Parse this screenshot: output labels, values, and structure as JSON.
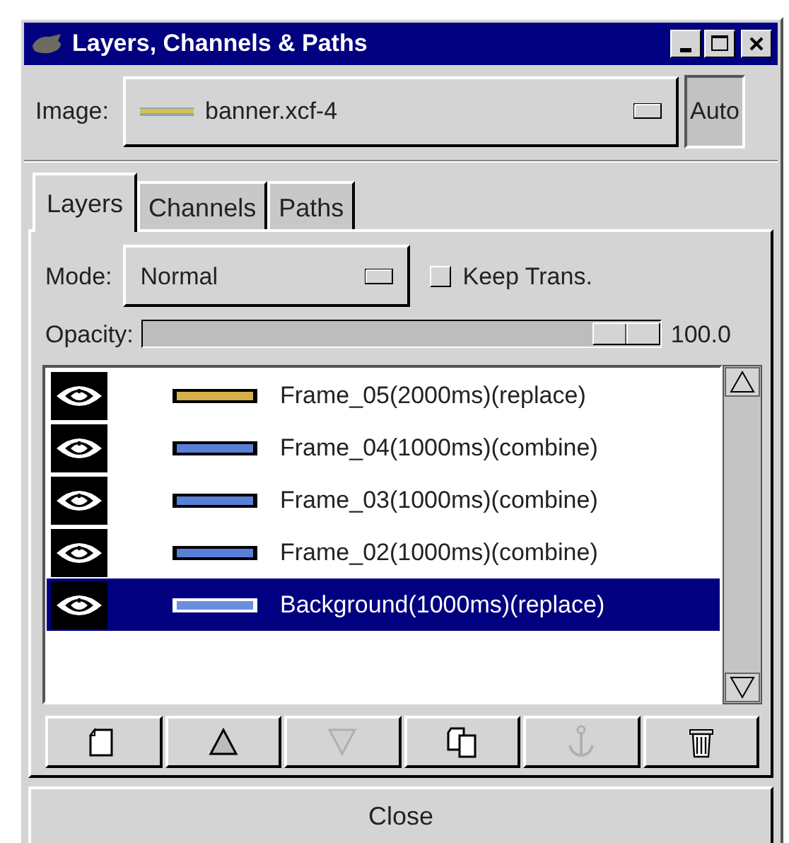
{
  "window": {
    "title": "Layers, Channels & Paths"
  },
  "image": {
    "label": "Image:",
    "value": "banner.xcf-4",
    "auto": "Auto"
  },
  "tabs": [
    {
      "label": "Layers",
      "selected": true
    },
    {
      "label": "Channels",
      "selected": false
    },
    {
      "label": "Paths",
      "selected": false
    }
  ],
  "mode": {
    "label": "Mode:",
    "value": "Normal"
  },
  "keep_trans": {
    "label": "Keep Trans.",
    "checked": false
  },
  "opacity": {
    "label": "Opacity:",
    "level": 1,
    "reading": "100.0"
  },
  "layers": [
    {
      "name": "Frame_05(2000ms)(replace)",
      "visible": true,
      "selected": false,
      "color": "#d4b048"
    },
    {
      "name": "Frame_04(1000ms)(combine)",
      "visible": true,
      "selected": false,
      "color": "#5a7fd8"
    },
    {
      "name": "Frame_03(1000ms)(combine)",
      "visible": true,
      "selected": false,
      "color": "#5a7fd8"
    },
    {
      "name": "Frame_02(1000ms)(combine)",
      "visible": true,
      "selected": false,
      "color": "#5a7fd8"
    },
    {
      "name": "Background(1000ms)(replace)",
      "visible": true,
      "selected": true,
      "color": "#6a8fe0"
    }
  ],
  "buttons": [
    {
      "kind": "new",
      "disabled": false
    },
    {
      "kind": "raise",
      "disabled": false
    },
    {
      "kind": "lower",
      "disabled": true
    },
    {
      "kind": "duplicate",
      "disabled": false
    },
    {
      "kind": "anchor",
      "disabled": true
    },
    {
      "kind": "delete",
      "disabled": false
    }
  ],
  "close": "Close"
}
